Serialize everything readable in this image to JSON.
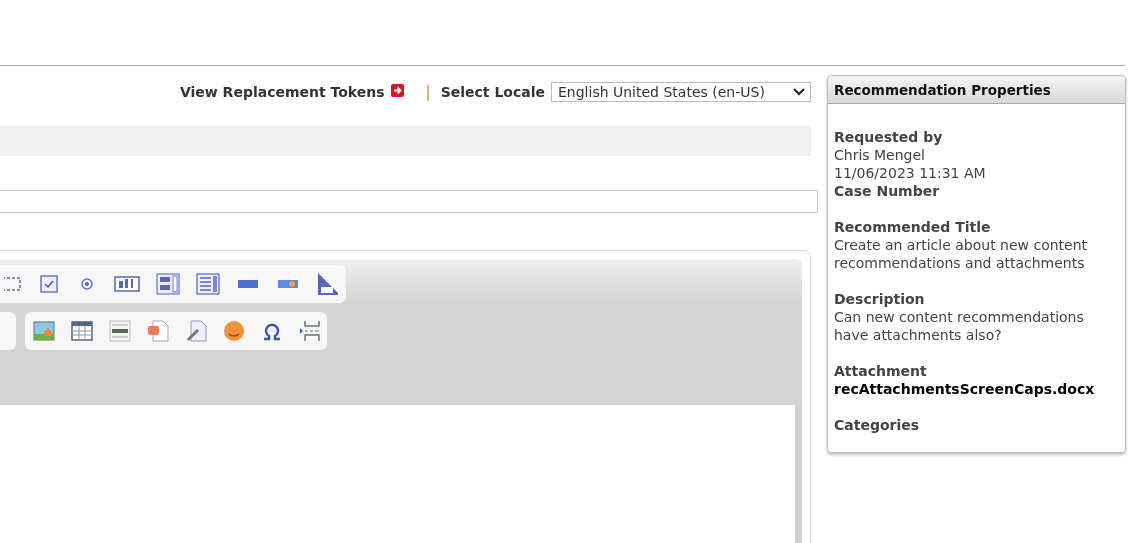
{
  "header": {
    "tokens_link": "View Replacement Tokens",
    "separator": "|",
    "locale_label": "Select Locale",
    "locale_value": "English United States (en-US)"
  },
  "panel": {
    "title": "Recommendation Properties",
    "fields": [
      {
        "kind": "meta",
        "label": "Requested by",
        "lines": [
          "Chris Mengel",
          "11/06/2023 11:31 AM"
        ]
      },
      {
        "kind": "text",
        "label": "Case Number"
      },
      {
        "kind": "text",
        "label": "Recommended Title",
        "lines": [
          "Create an article about new content recommendations and attachments"
        ]
      },
      {
        "kind": "text",
        "label": "Description",
        "lines": [
          "Can new content recommendations have attachments also?"
        ]
      },
      {
        "kind": "file",
        "label": "Attachment",
        "lines": [
          "recAttachmentsScreenCaps.docx"
        ]
      },
      {
        "kind": "text",
        "label": "Categories"
      }
    ]
  }
}
